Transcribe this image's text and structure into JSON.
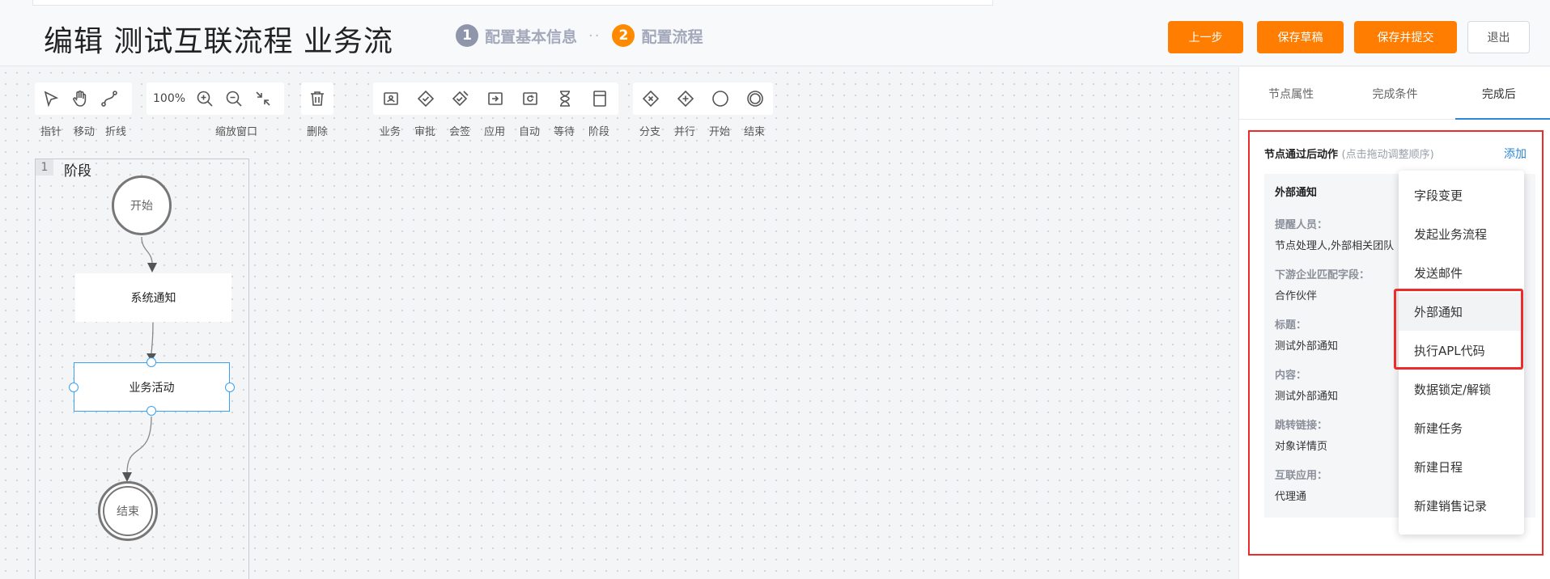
{
  "header": {
    "title": "编辑 测试互联流程 业务流",
    "steps": [
      {
        "num": "1",
        "label": "配置基本信息"
      },
      {
        "num": "2",
        "label": "配置流程"
      }
    ],
    "step_separator": "··",
    "buttons": {
      "prev": "上一步",
      "save_draft": "保存草稿",
      "save_submit": "保存并提交",
      "exit": "退出"
    }
  },
  "toolbar": {
    "pointer": "指针",
    "move": "移动",
    "polyline": "折线",
    "zoom_value": "100%",
    "zoom_group": "缩放窗口",
    "delete": "删除",
    "business": "业务",
    "approval": "审批",
    "countersign": "会签",
    "application": "应用",
    "auto": "自动",
    "wait": "等待",
    "stage": "阶段",
    "branch": "分支",
    "parallel": "并行",
    "start": "开始",
    "end": "结束"
  },
  "flow": {
    "lane_number": "1",
    "lane_title": "阶段",
    "start_node": "开始",
    "system_notice": "系统通知",
    "business_activity": "业务活动",
    "end_node": "结束"
  },
  "panel": {
    "tabs": [
      "节点属性",
      "完成条件",
      "完成后"
    ],
    "active_tab": "完成后",
    "section_title": "节点通过后动作",
    "section_hint": "(点击拖动调整顺序)",
    "add": "添加",
    "card": {
      "title": "外部通知",
      "fields": [
        {
          "label": "提醒人员：",
          "value": "节点处理人,外部相关团队"
        },
        {
          "label": "下游企业匹配字段：",
          "value": "合作伙伴"
        },
        {
          "label": "标题：",
          "value": "测试外部通知"
        },
        {
          "label": "内容：",
          "value": "测试外部通知"
        },
        {
          "label": "跳转链接：",
          "value": "对象详情页"
        },
        {
          "label": "互联应用：",
          "value": "代理通"
        }
      ]
    }
  },
  "dropdown": {
    "items": [
      "字段变更",
      "发起业务流程",
      "发送邮件",
      "外部通知",
      "执行APL代码",
      "数据锁定/解锁",
      "新建任务",
      "新建日程",
      "新建销售记录"
    ],
    "highlighted": "外部通知"
  },
  "colors": {
    "accent_orange": "#ff7d00",
    "link_blue": "#2c87d6",
    "annotation_red": "#ee2b2b",
    "selection_blue": "#3aa1f2"
  }
}
